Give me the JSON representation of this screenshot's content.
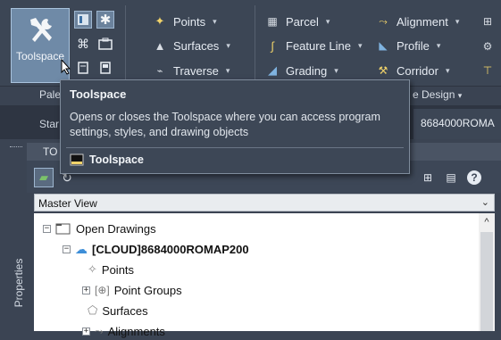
{
  "ribbon": {
    "toolspace_label": "Toolspace",
    "col1": [
      {
        "label": "Points",
        "icon": "points-icon"
      },
      {
        "label": "Surfaces",
        "icon": "surfaces-icon"
      },
      {
        "label": "Traverse",
        "icon": "traverse-icon"
      }
    ],
    "col2": [
      {
        "label": "Parcel",
        "icon": "parcel-icon"
      },
      {
        "label": "Feature Line",
        "icon": "feature-line-icon"
      },
      {
        "label": "Grading",
        "icon": "grading-icon"
      }
    ],
    "col3": [
      {
        "label": "Alignment",
        "icon": "alignment-icon"
      },
      {
        "label": "Profile",
        "icon": "profile-icon"
      },
      {
        "label": "Corridor",
        "icon": "corridor-icon"
      }
    ],
    "panel_label": "Pale",
    "design_label": "e Design"
  },
  "tabs": {
    "start": "Star",
    "drawing": "8684000ROMA"
  },
  "palette": {
    "title": "TO",
    "side_tab": "Properties",
    "view_select": "Master View"
  },
  "tree": {
    "root": "Open Drawings",
    "drawing": "[CLOUD]8684000ROMAP200",
    "items": [
      "Points",
      "Point Groups",
      "Surfaces",
      "Alignments"
    ]
  },
  "tooltip": {
    "title": "Toolspace",
    "description": "Opens or closes the Toolspace where you can access program settings, styles, and drawing objects",
    "command": "Toolspace"
  },
  "colors": {
    "ribbon_bg": "#3c4655",
    "highlight": "#6f8aa7",
    "tooltip_bg": "#3d4756"
  }
}
